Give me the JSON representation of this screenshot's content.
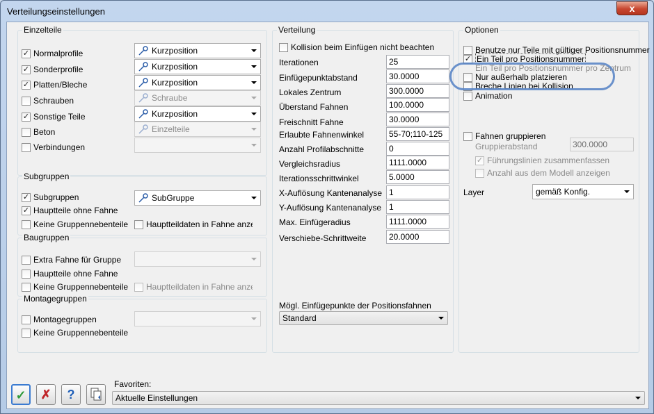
{
  "window": {
    "title": "Verteilungseinstellungen",
    "close_glyph": "x"
  },
  "einzelteile": {
    "title": "Einzelteile",
    "rows": [
      {
        "label": "Normalprofile",
        "checked": true,
        "combo": "Kurzposition",
        "enabled": true
      },
      {
        "label": "Sonderprofile",
        "checked": true,
        "combo": "Kurzposition",
        "enabled": true
      },
      {
        "label": "Platten/Bleche",
        "checked": true,
        "combo": "Kurzposition",
        "enabled": true
      },
      {
        "label": "Schrauben",
        "checked": false,
        "combo": "Schraube",
        "enabled": false
      },
      {
        "label": "Sonstige Teile",
        "checked": true,
        "combo": "Kurzposition",
        "enabled": true
      },
      {
        "label": "Beton",
        "checked": false,
        "combo": "Einzelteile",
        "enabled": false
      },
      {
        "label": "Verbindungen",
        "checked": false,
        "combo": "",
        "enabled": false
      }
    ]
  },
  "subgruppen": {
    "title": "Subgruppen",
    "subgruppen_label": "Subgruppen",
    "subgruppen_combo": "SubGruppe",
    "hauptteile_label": "Hauptteile ohne Fahne",
    "keine_label": "Keine Gruppennebenteile",
    "hauptteildaten_label": "Hauptteildaten in Fahne anzeigen"
  },
  "baugruppen": {
    "title": "Baugruppen",
    "extra_label": "Extra Fahne für Gruppe",
    "hauptteile_label": "Hauptteile ohne Fahne",
    "keine_label": "Keine Gruppennebenteile",
    "hauptteildaten_label": "Hauptteildaten in Fahne anzeigen"
  },
  "montagegruppen": {
    "title": "Montagegruppen",
    "montage_label": "Montagegruppen",
    "keine_label": "Keine Gruppennebenteile"
  },
  "verteilung": {
    "title": "Verteilung",
    "kollision_label": "Kollision beim Einfügen nicht beachten",
    "fields": [
      {
        "label": "Iterationen",
        "value": "25"
      },
      {
        "label": "Einfügepunktabstand",
        "value": "30.0000"
      },
      {
        "label": "Lokales Zentrum",
        "value": "300.0000"
      },
      {
        "label": "Überstand Fahnen",
        "value": "100.0000"
      },
      {
        "label": "Freischnitt Fahne",
        "value": "30.0000"
      },
      {
        "label": "Erlaubte Fahnenwinkel",
        "value": "55-70;110-125"
      },
      {
        "label": "Anzahl Profilabschnitte",
        "value": "0"
      },
      {
        "label": "Vergleichsradius",
        "value": "1111.0000"
      },
      {
        "label": "Iterationsschrittwinkel",
        "value": "5.0000"
      },
      {
        "label": "X-Auflösung Kantenanalyse",
        "value": "1"
      },
      {
        "label": "Y-Auflösung Kantenanalyse",
        "value": "1"
      },
      {
        "label": "Max. Einfügeradius",
        "value": "1111.0000"
      },
      {
        "label": "Verschiebe-Schrittweite",
        "value": "20.0000"
      }
    ],
    "einfuege_label": "Mögl. Einfügepunkte der Positionsfahnen",
    "einfuege_value": "Standard"
  },
  "optionen": {
    "title": "Optionen",
    "benutze_label": "Benutze nur Teile mit gültiger Positionsnummer",
    "ein_teil_label": "Ein Teil pro Positionsnummer",
    "ein_teil_zentrum_label": "Ein Teil pro Positionsnummer pro Zentrum",
    "nur_ausserhalb_label": "Nur außerhalb platzieren",
    "breche_label": "Breche Linien bei Kollision",
    "animation_label": "Animation",
    "fahnen_gruppieren_label": "Fahnen gruppieren",
    "gruppierabstand_label": "Gruppierabstand",
    "gruppierabstand_value": "300.0000",
    "fuehrungslinien_label": "Führungslinien zusammenfassen",
    "anzahl_label": "Anzahl aus dem Modell anzeigen",
    "layer_label": "Layer",
    "layer_value": "gemäß Konfig."
  },
  "footer": {
    "favoriten_label": "Favoriten:",
    "favoriten_value": "Aktuelle Einstellungen",
    "help_glyph": "?"
  },
  "colors": {
    "ok_green": "#2f9a3a",
    "cancel_red": "#c0262a",
    "help_blue": "#1f5fb8",
    "highlight": "#5b86c7"
  }
}
